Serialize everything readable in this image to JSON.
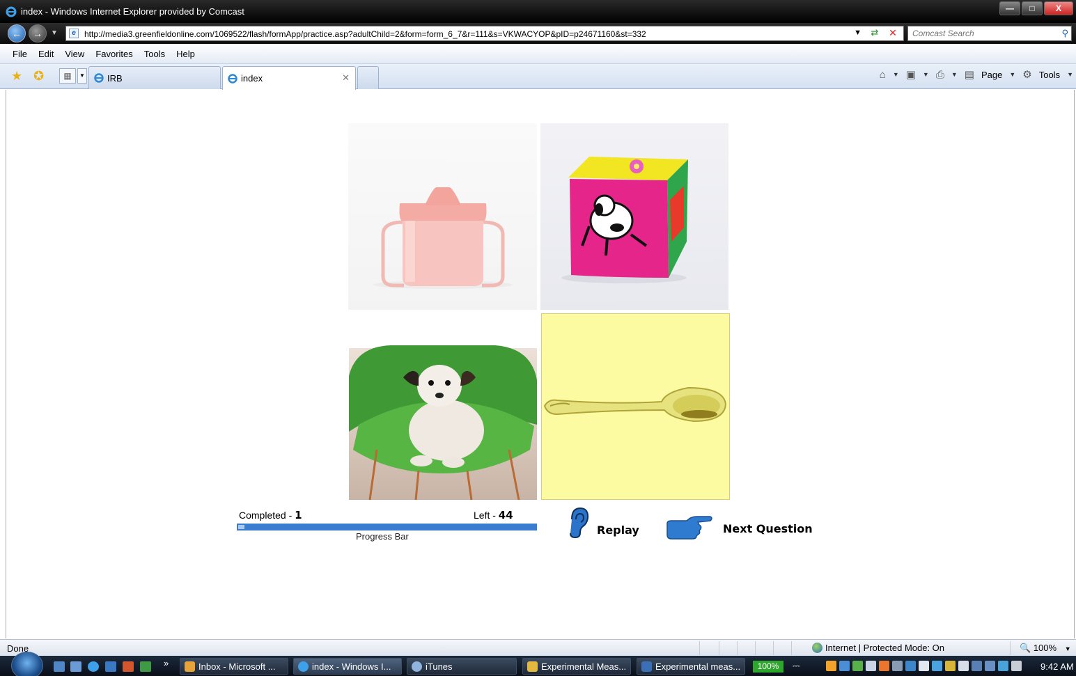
{
  "window": {
    "title": "index - Windows Internet Explorer provided by Comcast",
    "min_label": "—",
    "max_label": "□",
    "close_label": "X"
  },
  "address": {
    "url": "http://media3.greenfieldonline.com/1069522/flash/formApp/practice.asp?adultChild=2&form=form_6_7&r=111&s=VKWACYOP&pID=p24671160&st=332"
  },
  "search": {
    "placeholder": "Comcast Search"
  },
  "menu": {
    "items": [
      "File",
      "Edit",
      "View",
      "Favorites",
      "Tools",
      "Help"
    ]
  },
  "tabs": [
    {
      "label": "IRB"
    },
    {
      "label": "index"
    }
  ],
  "command_bar": {
    "page_label": "Page",
    "tools_label": "Tools"
  },
  "quiz": {
    "images": [
      "sippy-cup",
      "toy-block",
      "dog-on-chair",
      "spoon"
    ],
    "completed_label": "Completed -",
    "completed_value": "1",
    "left_label": "Left -",
    "left_value": "44",
    "progress_fraction": 0.022,
    "progress_label": "Progress Bar",
    "replay_label": "Replay",
    "next_label": "Next Question",
    "progress_color": "#3a7ccf",
    "highlight_color": "#fdfba1"
  },
  "status": {
    "text": "Done",
    "zone": "Internet | Protected Mode: On",
    "zoom": "100%"
  },
  "taskbar": {
    "buttons": [
      {
        "label": "Inbox - Microsoft ..."
      },
      {
        "label": "index - Windows I..."
      },
      {
        "label": "iTunes"
      },
      {
        "label": "Experimental Meas..."
      },
      {
        "label": "Experimental meas..."
      }
    ],
    "battery": "100%",
    "overflow": "»",
    "clock": "9:42 AM"
  }
}
